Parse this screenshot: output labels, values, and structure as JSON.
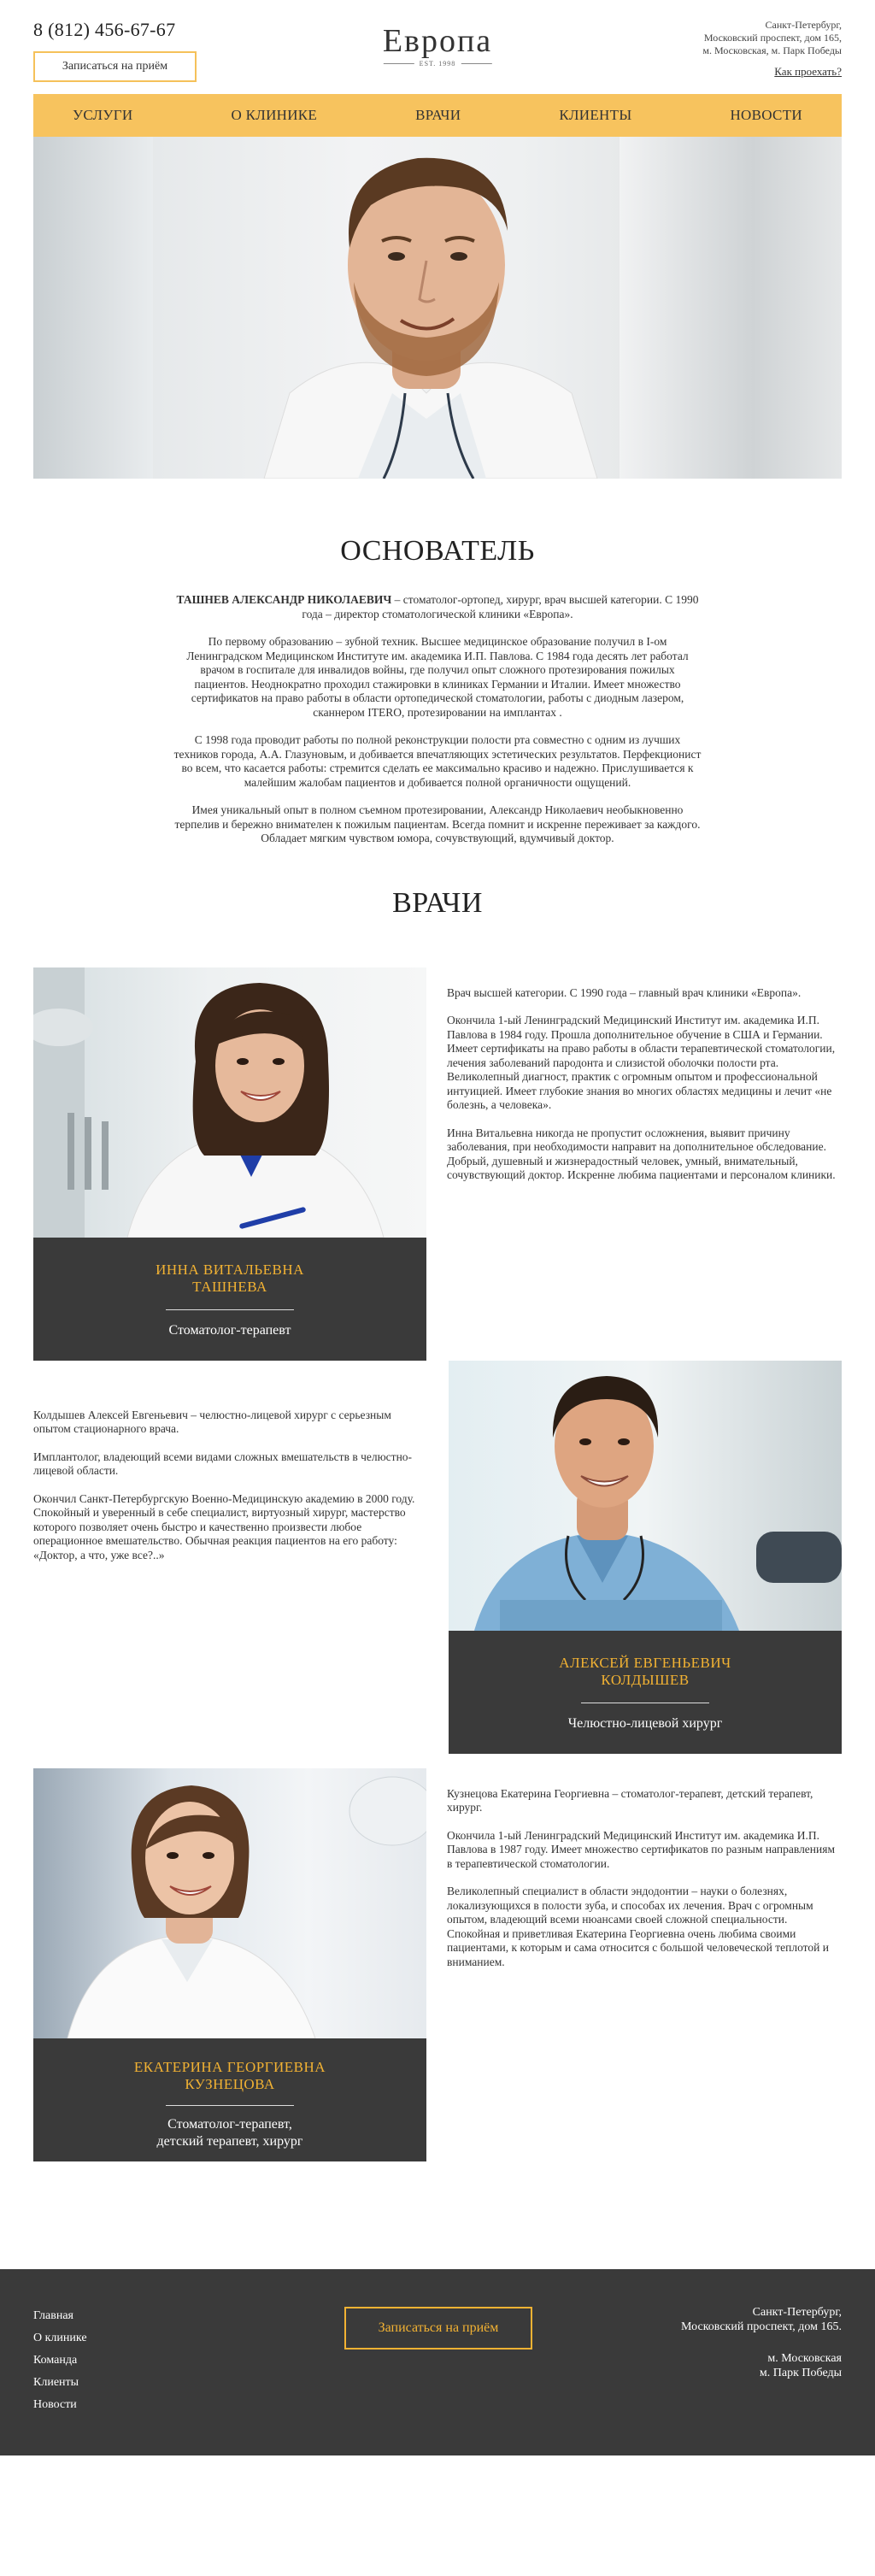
{
  "header": {
    "phone": "8 (812) 456-67-67",
    "book_label": "Записаться на приём",
    "logo_title": "Европа",
    "logo_sub": "EST. 1998",
    "address_lines": [
      "Санкт-Петербург,",
      "Московский проспект, дом 165,",
      "м. Московская, м. Парк Победы"
    ],
    "how_to_get": "Как проехать?"
  },
  "nav": [
    "УСЛУГИ",
    "О КЛИНИКЕ",
    "ВРАЧИ",
    "КЛИЕНТЫ",
    "НОВОСТИ"
  ],
  "founder": {
    "title": "ОСНОВАТЕЛЬ",
    "name": "ТАШНЕВ АЛЕКСАНДР НИКОЛАЕВИЧ",
    "intro": " – стоматолог-ортопед, хирург, врач высшей категории. С 1990 года – директор стоматологической клиники «Европа».",
    "p2": "По первому образованию – зубной техник. Высшее медицинское образование получил в I-ом Ленинградском Медицинском Институте им. академика И.П. Павлова. С 1984 года десять лет работал врачом в госпитале для инвалидов войны, где получил опыт сложного протезирования пожилых пациентов. Неоднократно проходил стажировки в клиниках Германии и Италии. Имеет множество сертификатов на право работы в области ортопедической стоматологии, работы с диодным лазером, сканнером ITERO, протезировании на имплантах .",
    "p3": "С 1998 года проводит работы по полной реконструкции полости рта совместно с одним из лучших техников  города, А.А. Глазуновым, и добивается впечатляющих эстетических результатов. Перфекционист во всем, что касается работы: стремится сделать ее максимально красиво и надежно. Прислушивается к малейшим жалобам пациентов и добивается полной органичности ощущений.",
    "p4": "Имея уникальный опыт в полном съемном протезировании, Александр Николаевич необыкновенно терпелив и бережно внимателен к пожилым пациентам. Всегда помнит и искренне переживает за каждого. Обладает мягким чувством юмора, сочувствующий, вдумчивый доктор."
  },
  "doctors_title": "ВРАЧИ",
  "doctors": [
    {
      "name_line1": "ИННА ВИТАЛЬЕВНА",
      "name_line2": "ТАШНЕВА",
      "role_line1": "Стоматолог-терапевт",
      "role_line2": "",
      "paragraphs": [
        "Врач высшей категории. С 1990 года – главный врач клиники «Европа».",
        "Окончила 1-ый Ленинградский Медицинский Институт им. академика И.П. Павлова в 1984 году. Прошла дополнительное обучение в США и Германии. Имеет сертификаты на право работы в области терапевтической стоматологии, лечения заболеваний пародонта и слизистой оболочки полости рта. Великолепный диагност, практик с огромным опытом и профессиональной интуицией. Имеет глубокие знания во многих областях медицины и лечит «не болезнь, а человека».",
        "Инна Витальевна никогда не пропустит осложнения, выявит причину заболевания, при необходимости направит на дополнительное обследование. Добрый, душевный и жизнерадостный человек, умный, внимательный, сочувствующий доктор. Искренне любима пациентами и персоналом клиники."
      ]
    },
    {
      "name_line1": "АЛЕКСЕЙ ЕВГЕНЬЕВИЧ",
      "name_line2": "КОЛДЫШЕВ",
      "role_line1": "Челюстно-лицевой хирург",
      "role_line2": "",
      "paragraphs": [
        "Колдышев Алексей Евгеньевич – челюстно-лицевой хирург с серьезным опытом стационарного врача.",
        "Имплантолог, владеющий всеми видами сложных вмешательств в челюстно-лицевой области.",
        "Окончил Санкт-Петербургскую Военно-Медицинскую академию в 2000 году. Спокойный и уверенный в себе специалист, виртуозный хирург, мастерство которого позволяет очень быстро и качественно произвести любое операционное вмешательство. Обычная реакция пациентов на его работу: «Доктор, а что, уже все?..»"
      ]
    },
    {
      "name_line1": "ЕКАТЕРИНА ГЕОРГИЕВНА",
      "name_line2": "КУЗНЕЦОВА",
      "role_line1": "Стоматолог-терапевт,",
      "role_line2": "детский терапевт, хирург",
      "paragraphs": [
        "Кузнецова Екатерина Георгиевна – стоматолог-терапевт, детский терапевт, хирург.",
        "Окончила 1-ый Ленинградский Медицинский Институт им. академика И.П. Павлова в 1987 году. Имеет множество сертификатов по разным направлениям в терапевтической стоматологии.",
        "Великолепный специалист в области эндодонтии – науки о болезнях, локализующихся в полости зуба, и способах их лечения. Врач с огромным опытом, владеющий всеми нюансами своей сложной специальности. Спокойная и приветливая Екатерина Георгиевна очень любима своими пациентами, к которым и сама относится с большой человеческой теплотой и вниманием."
      ]
    }
  ],
  "footer": {
    "links": [
      "Главная",
      "О клинике",
      "Команда",
      "Клиенты",
      "Новости"
    ],
    "book_label": "Записаться на приём",
    "address_1": [
      "Санкт-Петербург,",
      "Московский проспект, дом 165."
    ],
    "address_2": [
      "м. Московская",
      "м. Парк Победы"
    ]
  },
  "colors": {
    "accent": "#f7c35e",
    "gold_text": "#f2b233",
    "dark": "#3a3a3a"
  }
}
